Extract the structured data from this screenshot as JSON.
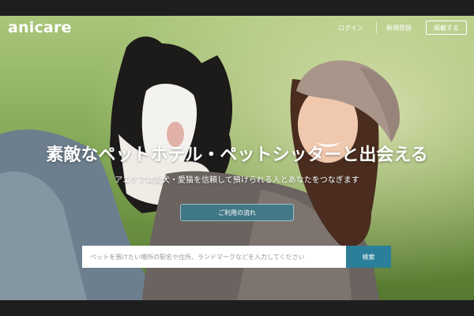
{
  "header": {
    "logo": "anicare",
    "login_label": "ログイン",
    "signup_label": "新規登録",
    "post_label": "掲載する"
  },
  "hero": {
    "headline": "素敵なペットホテル・ペットシッターと出会える",
    "subheadline": "アニケアは愛犬・愛猫を信頼して預けられる人とあなたをつなぎます",
    "flow_button_label": "ご利用の流れ"
  },
  "search": {
    "placeholder": "ペットを預けたい場所の駅名や住所、ランドマークなどを入力してください",
    "button_label": "検索"
  },
  "colors": {
    "accent": "#2c7f98",
    "chrome": "#1e1e1e"
  }
}
